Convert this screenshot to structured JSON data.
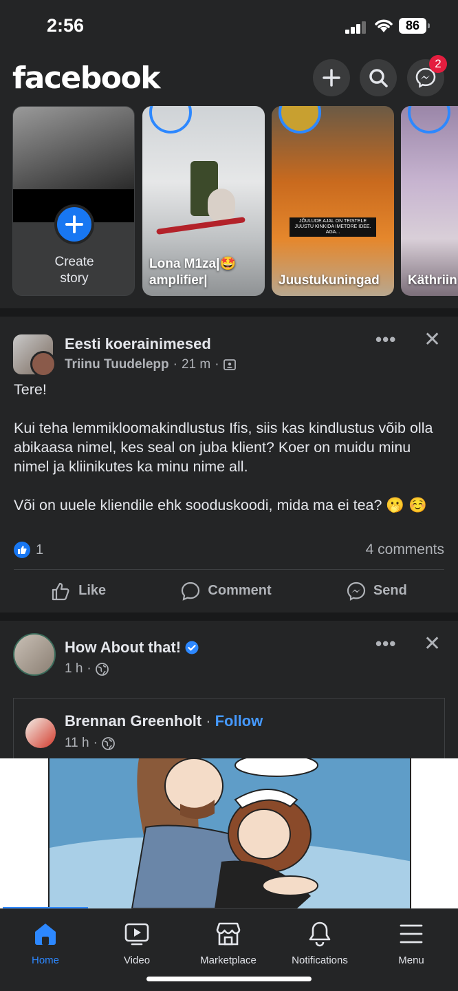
{
  "status": {
    "time": "2:56",
    "battery": "86"
  },
  "header": {
    "logo": "facebook",
    "messenger_badge": "2"
  },
  "stories": [
    {
      "label_line1": "Create",
      "label_line2": "story"
    },
    {
      "label": "Lona M1za|🤩 amplifier|"
    },
    {
      "label": "Juustukuningad",
      "image_text": "JÕULUDE AJAL ON TEISTELE JUUSTU KINKIDA IMETORE IDEE. AGA..."
    },
    {
      "label": "Käthriin"
    }
  ],
  "post1": {
    "group": "Eesti koerainimesed",
    "author": "Triinu Tuudelepp",
    "time": "21 m",
    "separator": "·",
    "body_p1": "Tere!",
    "body_p2": "Kui teha lemmikloomakindlustus Ifis, siis kas kindlustus võib olla abikaasa nimel, kes seal on juba klient? Koer on muidu minu nimel ja kliinikutes ka minu nime all.",
    "body_p3": "Või on uuele kliendile ehk sooduskoodi, mida ma ei tea? 🫢 ☺️",
    "likes": "1",
    "comments": "4 comments"
  },
  "actions": {
    "like": "Like",
    "comment": "Comment",
    "send": "Send"
  },
  "post2": {
    "page": "How About that!",
    "time": "1 h",
    "separator": "·",
    "shared_author": "Brennan Greenholt",
    "follow": "Follow",
    "shared_time": "11 h"
  },
  "tabs": {
    "home": "Home",
    "video": "Video",
    "marketplace": "Marketplace",
    "notifications": "Notifications",
    "menu": "Menu"
  },
  "colors": {
    "accent": "#2d88ff",
    "brand": "#1877f2",
    "badge": "#e41e3f",
    "bg": "#242526",
    "verified": "#2d88ff"
  }
}
